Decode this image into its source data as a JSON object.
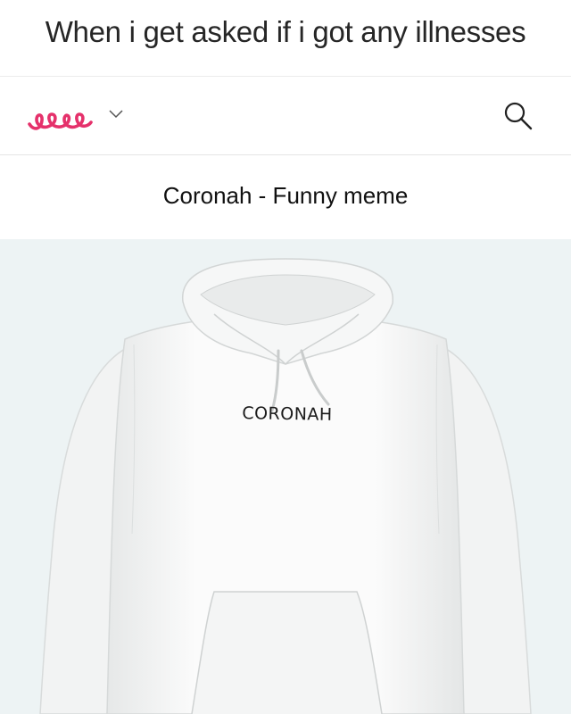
{
  "meme": {
    "caption": "When i get asked if i got any illnesses"
  },
  "header": {
    "logo_icon": "teespring-loops-logo",
    "logo_color": "#e5316b",
    "dropdown_icon": "chevron-down",
    "search_icon": "magnifier"
  },
  "product": {
    "title": "Coronah - Funny meme",
    "image_background": "#edf3f4",
    "garment": "white hoodie",
    "print_text": "CORONAH"
  }
}
